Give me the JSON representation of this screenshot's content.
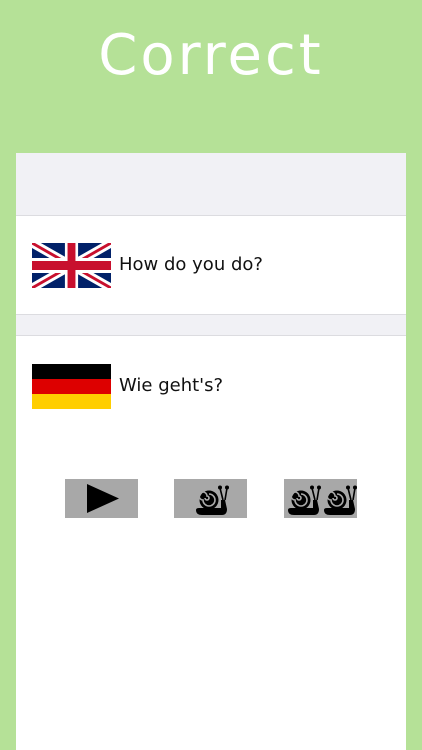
{
  "header": {
    "title": "Correct"
  },
  "rows": [
    {
      "language": "English",
      "flag_icon": "uk-flag-icon",
      "phrase": "How do you do?"
    },
    {
      "language": "German",
      "flag_icon": "germany-flag-icon",
      "phrase": "Wie geht's?"
    }
  ],
  "controls": {
    "play": {
      "icon": "play-icon"
    },
    "slow": {
      "icon": "snail-icon"
    },
    "slower": {
      "icon": "two-snails-icon"
    }
  },
  "colors": {
    "background": "#b5e197",
    "panel": "#ffffff",
    "header_strip": "#f1f1f5",
    "button": "#a8a8a8",
    "icon": "#000000"
  }
}
